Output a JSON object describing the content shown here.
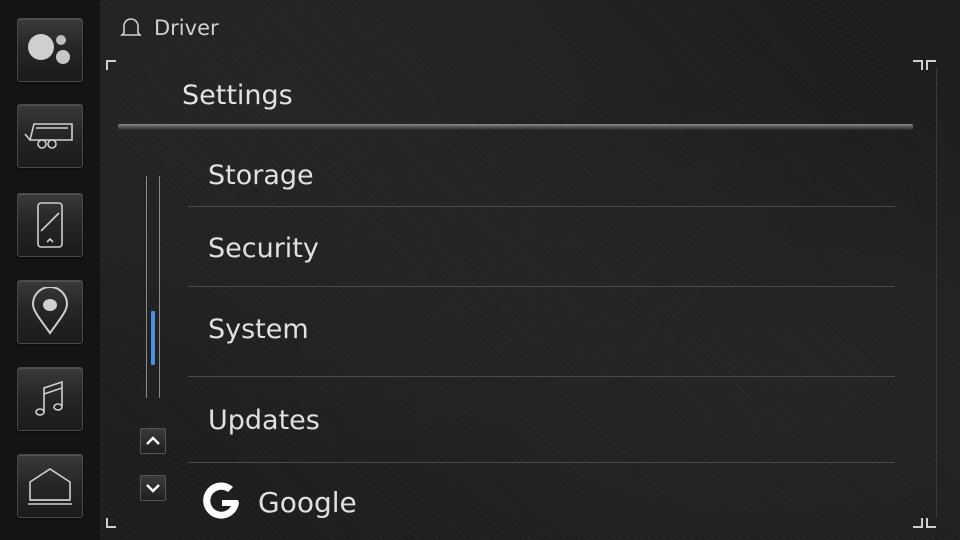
{
  "header": {
    "profile_label": "Driver"
  },
  "page": {
    "title": "Settings"
  },
  "menu": {
    "items": [
      {
        "label": "Storage"
      },
      {
        "label": "Security"
      },
      {
        "label": "System"
      },
      {
        "label": "Updates"
      },
      {
        "label": "Google"
      }
    ]
  },
  "sidebar": {
    "buttons": [
      {
        "icon": "assistant-icon"
      },
      {
        "icon": "trailer-icon"
      },
      {
        "icon": "phone-icon"
      },
      {
        "icon": "map-pin-icon"
      },
      {
        "icon": "music-note-icon"
      },
      {
        "icon": "home-icon"
      }
    ]
  },
  "colors": {
    "accent": "#4a90e2",
    "background": "#1e1e1e",
    "text": "#e0e0e0"
  }
}
